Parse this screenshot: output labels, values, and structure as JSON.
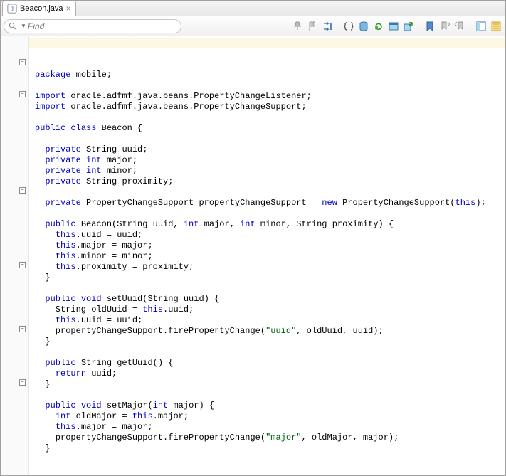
{
  "tab": {
    "filename": "Beacon.java"
  },
  "search": {
    "placeholder": "Find"
  },
  "code": {
    "l1_kw": "package",
    "l1_rest": " mobile;",
    "l3_kw": "import",
    "l3_rest": " oracle.adfmf.java.beans.PropertyChangeListener;",
    "l4_kw": "import",
    "l4_rest": " oracle.adfmf.java.beans.PropertyChangeSupport;",
    "l6_kw1": "public",
    "l6_kw2": "class",
    "l6_rest": " Beacon {",
    "l8_kw": "private",
    "l8_rest": " String uuid;",
    "l9_kw1": "private",
    "l9_kw2": "int",
    "l9_rest": " major;",
    "l10_kw1": "private",
    "l10_kw2": "int",
    "l10_rest": " minor;",
    "l11_kw": "private",
    "l11_rest": " String proximity;",
    "l13_kw1": "private",
    "l13_mid": " PropertyChangeSupport propertyChangeSupport = ",
    "l13_kw2": "new",
    "l13_mid2": " PropertyChangeSupport(",
    "l13_kw3": "this",
    "l13_end": ");",
    "l15_kw": "public",
    "l15_mid1": " Beacon(String uuid, ",
    "l15_kw2": "int",
    "l15_mid2": " major, ",
    "l15_kw3": "int",
    "l15_end": " minor, String proximity) {",
    "l16_this": "this",
    "l16_rest": ".uuid = uuid;",
    "l17_this": "this",
    "l17_rest": ".major = major;",
    "l18_this": "this",
    "l18_rest": ".minor = minor;",
    "l19_this": "this",
    "l19_rest": ".proximity = proximity;",
    "l20": "  }",
    "l22_kw1": "public",
    "l22_kw2": "void",
    "l22_rest": " setUuid(String uuid) {",
    "l23_pre": "    String oldUuid = ",
    "l23_this": "this",
    "l23_rest": ".uuid;",
    "l24_this": "this",
    "l24_rest": ".uuid = uuid;",
    "l25_pre": "    propertyChangeSupport.firePropertyChange(",
    "l25_str": "\"uuid\"",
    "l25_end": ", oldUuid, uuid);",
    "l26": "  }",
    "l28_kw": "public",
    "l28_rest": " String getUuid() {",
    "l29_kw": "return",
    "l29_rest": " uuid;",
    "l30": "  }",
    "l32_kw1": "public",
    "l32_kw2": "void",
    "l32_mid": " setMajor(",
    "l32_kw3": "int",
    "l32_end": " major) {",
    "l33_kw": "int",
    "l33_mid": " oldMajor = ",
    "l33_this": "this",
    "l33_rest": ".major;",
    "l34_this": "this",
    "l34_rest": ".major = major;",
    "l35_pre": "    propertyChangeSupport.firePropertyChange(",
    "l35_str": "\"major\"",
    "l35_end": ", oldMajor, major);",
    "l36": "  }"
  }
}
